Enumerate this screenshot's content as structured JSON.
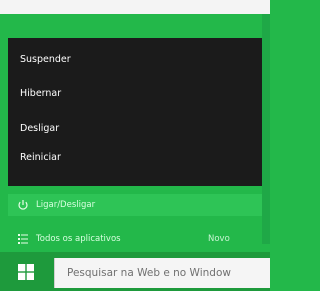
{
  "power_menu": {
    "items": [
      {
        "label": "Suspender"
      },
      {
        "label": "Hibernar"
      },
      {
        "label": "Desligar"
      },
      {
        "label": "Reiniciar"
      }
    ]
  },
  "start_menu": {
    "power_label": "Ligar/Desligar",
    "all_apps_label": "Todos os aplicativos",
    "new_badge": "Novo"
  },
  "taskbar": {
    "search_placeholder": "Pesquisar na Web e no Window"
  },
  "colors": {
    "accent": "#23b84a",
    "menu_bg": "#1b1b1b"
  }
}
